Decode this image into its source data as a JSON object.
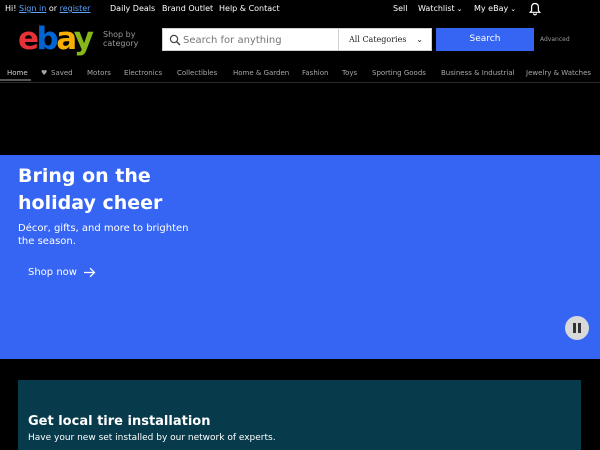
{
  "topbar": {
    "greeting": "Hi! ",
    "sign_in": "Sign in",
    "or": " or ",
    "register": "register",
    "links": [
      "Daily Deals",
      "Brand Outlet",
      "Help & Contact"
    ],
    "sell": "Sell",
    "watchlist": "Watchlist",
    "myebay": "My eBay"
  },
  "header": {
    "logo": {
      "e": "e",
      "b": "b",
      "a": "a",
      "y": "y"
    },
    "shop_by_category": [
      "Shop by",
      "category"
    ],
    "search_placeholder": "Search for anything",
    "category_select": "All Categories",
    "search_button": "Search",
    "advanced": "Advanced"
  },
  "nav": {
    "items": [
      "Home",
      "Saved",
      "Motors",
      "Electronics",
      "Collectibles",
      "Home & Garden",
      "Fashion",
      "Toys",
      "Sporting Goods",
      "Business & Industrial",
      "Jewelry & Watches"
    ]
  },
  "hero": {
    "title": "Bring on the holiday cheer",
    "subtitle": "Décor, gifts, and more to brighten the season.",
    "cta": "Shop now",
    "background": "#3665f3"
  },
  "promo": {
    "title": "Get local tire installation",
    "subtitle": "Have your new set installed by our network of experts.",
    "background": "#073b4c"
  },
  "icons": {
    "bell": "bell-icon",
    "search": "search-icon",
    "pause": "pause-icon",
    "arrow": "arrow-right-icon",
    "heart": "heart-icon"
  }
}
